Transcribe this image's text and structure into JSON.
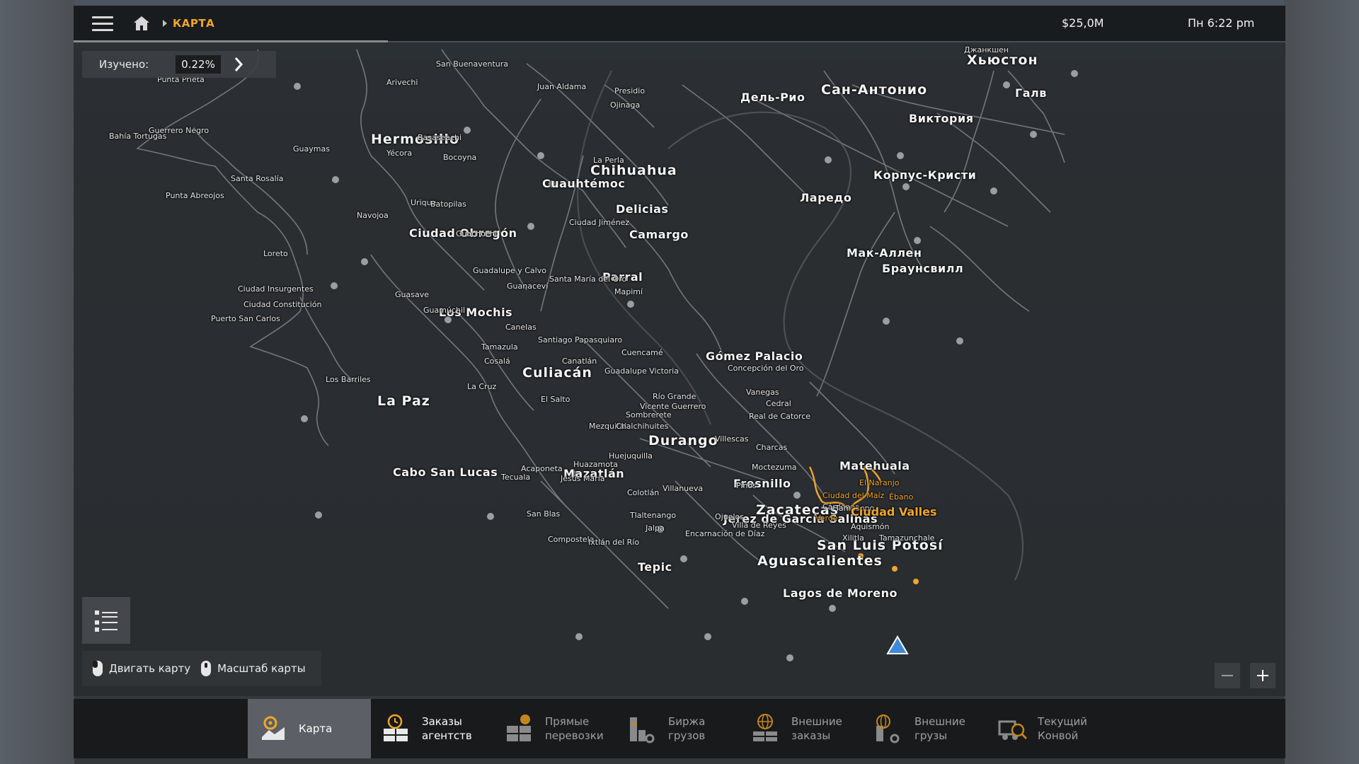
{
  "header": {
    "breadcrumb": "КАРТА",
    "money": "$25,0M",
    "clock": "Пн 6:22 pm"
  },
  "explored": {
    "label": "Изучено:",
    "value": "0.22%"
  },
  "hints": {
    "move": "Двигать карту",
    "zoom": "Масштаб карты"
  },
  "nav": {
    "items": [
      {
        "line1": "Карта",
        "line2": ""
      },
      {
        "line1": "Заказы",
        "line2": "агентств"
      },
      {
        "line1": "Прямые",
        "line2": "перевозки"
      },
      {
        "line1": "Биржа",
        "line2": "грузов"
      },
      {
        "line1": "Внешние",
        "line2": "заказы"
      },
      {
        "line1": "Внешние",
        "line2": "грузы"
      },
      {
        "line1": "Текущий",
        "line2": "Конвой"
      }
    ]
  },
  "cities": {
    "big": [
      {
        "id": "hermosillo",
        "name": "Hermosillo"
      },
      {
        "id": "chihuahua",
        "name": "Chihuahua"
      },
      {
        "id": "cuauhtemoc",
        "name": "Cuauhtémoc"
      },
      {
        "id": "delicias",
        "name": "Delicias"
      },
      {
        "id": "camargo",
        "name": "Camargo"
      },
      {
        "id": "obregon",
        "name": "Ciudad Obregón"
      },
      {
        "id": "parral",
        "name": "Parral"
      },
      {
        "id": "losmochis",
        "name": "Los Mochis"
      },
      {
        "id": "culiacan",
        "name": "Culiacán"
      },
      {
        "id": "gomez",
        "name": "Gómez Palacio"
      },
      {
        "id": "lapaz",
        "name": "La Paz"
      },
      {
        "id": "cabo",
        "name": "Cabo San Lucas"
      },
      {
        "id": "durango",
        "name": "Durango"
      },
      {
        "id": "mazatlan",
        "name": "Mazatlán"
      },
      {
        "id": "fresnillo",
        "name": "Fresnillo"
      },
      {
        "id": "zacatecas",
        "name": "Zacatecas"
      },
      {
        "id": "jerez",
        "name": "Jerez de García Salinas"
      },
      {
        "id": "slp",
        "name": "San Luis Potosí"
      },
      {
        "id": "aguas",
        "name": "Aguascalientes"
      },
      {
        "id": "tepic",
        "name": "Tepic"
      },
      {
        "id": "lagos",
        "name": "Lagos de Moreno"
      },
      {
        "id": "matehuala",
        "name": "Matehuala"
      },
      {
        "id": "houston",
        "name": "Хьюстон"
      },
      {
        "id": "sanantonio",
        "name": "Сан-Антонио"
      },
      {
        "id": "delrio",
        "name": "Дель-Рио"
      },
      {
        "id": "victoria",
        "name": "Виктория"
      },
      {
        "id": "corpus",
        "name": "Корпус-Кристи"
      },
      {
        "id": "laredo",
        "name": "Ларедо"
      },
      {
        "id": "mcallen",
        "name": "Мак-Аллен"
      },
      {
        "id": "brownsville",
        "name": "Браунсвилл"
      },
      {
        "id": "galv",
        "name": "Галв"
      }
    ],
    "small": [
      {
        "id": "sanbuen",
        "name": "San Buenaventura"
      },
      {
        "id": "arivechi",
        "name": "Arivechi"
      },
      {
        "id": "juanaldama",
        "name": "Juan Aldama"
      },
      {
        "id": "presidio",
        "name": "Presidio"
      },
      {
        "id": "ojinaga",
        "name": "Ojinaga"
      },
      {
        "id": "puntaprieta",
        "name": "Punta Prieta"
      },
      {
        "id": "guerreronegro",
        "name": "Guerrero Negro"
      },
      {
        "id": "bahia",
        "name": "Bahía Tortugas"
      },
      {
        "id": "basaseachi",
        "name": "Basaseachi"
      },
      {
        "id": "guaymas",
        "name": "Guaymas"
      },
      {
        "id": "yecora",
        "name": "Yécora"
      },
      {
        "id": "bocoyna",
        "name": "Bocoyna"
      },
      {
        "id": "laperla",
        "name": "La Perla"
      },
      {
        "id": "santarosalia",
        "name": "Santa Rosalía"
      },
      {
        "id": "puntaabreojos",
        "name": "Punta Abreojos"
      },
      {
        "id": "urique",
        "name": "Urique"
      },
      {
        "id": "batopilas",
        "name": "Batopilas"
      },
      {
        "id": "navojoa",
        "name": "Navojoa"
      },
      {
        "id": "cdjimenez",
        "name": "Ciudad Jiménez"
      },
      {
        "id": "guachochi",
        "name": "Guachochi"
      },
      {
        "id": "loreto",
        "name": "Loreto"
      },
      {
        "id": "guadcalvo",
        "name": "Guadalupe y Calvo"
      },
      {
        "id": "guasave",
        "name": "Guasave"
      },
      {
        "id": "guanacevi",
        "name": "Guanaceví"
      },
      {
        "id": "santamaria",
        "name": "Santa María del Oro"
      },
      {
        "id": "cdinsurg",
        "name": "Ciudad Insurgentes"
      },
      {
        "id": "cdconst",
        "name": "Ciudad Constitución"
      },
      {
        "id": "mapimi",
        "name": "Mapimí"
      },
      {
        "id": "puertosc",
        "name": "Puerto San Carlos"
      },
      {
        "id": "guamuchil",
        "name": "Guamúchil"
      },
      {
        "id": "canelas",
        "name": "Canelas"
      },
      {
        "id": "santiagop",
        "name": "Santiago Papasquiaro"
      },
      {
        "id": "tamazula",
        "name": "Tamazula"
      },
      {
        "id": "cuencame",
        "name": "Cuencamé"
      },
      {
        "id": "cosala",
        "name": "Cosalá"
      },
      {
        "id": "canatlan",
        "name": "Canatlán"
      },
      {
        "id": "concepcion",
        "name": "Concepción del Oro"
      },
      {
        "id": "guadvictoria",
        "name": "Guadalupe Victoria"
      },
      {
        "id": "losbarriles",
        "name": "Los Barriles"
      },
      {
        "id": "lacruz",
        "name": "La Cruz"
      },
      {
        "id": "vanegas",
        "name": "Vanegas"
      },
      {
        "id": "riogrande",
        "name": "Río Grande"
      },
      {
        "id": "elsalto",
        "name": "El Salto"
      },
      {
        "id": "vicenteg",
        "name": "Vicente Guerrero"
      },
      {
        "id": "cedral",
        "name": "Cedral"
      },
      {
        "id": "sombrerete",
        "name": "Sombrerete"
      },
      {
        "id": "realcatorce",
        "name": "Real de Catorce"
      },
      {
        "id": "mezquital",
        "name": "Mezquital"
      },
      {
        "id": "chalchihuites",
        "name": "Chalchihuites"
      },
      {
        "id": "villaescusa",
        "name": "Villescas"
      },
      {
        "id": "charcas",
        "name": "Charcas"
      },
      {
        "id": "huejuquilla",
        "name": "Huejuquilla"
      },
      {
        "id": "huazamota",
        "name": "Huazamota"
      },
      {
        "id": "moctezuma",
        "name": "Moctezuma"
      },
      {
        "id": "acaponeta",
        "name": "Acaponeta"
      },
      {
        "id": "tecuala",
        "name": "Tecuala"
      },
      {
        "id": "jesusmaria",
        "name": "Jesús María"
      },
      {
        "id": "pinos",
        "name": "Pinos"
      },
      {
        "id": "colotlan",
        "name": "Colotlán"
      },
      {
        "id": "villanueva",
        "name": "Villanueva"
      },
      {
        "id": "sanblas",
        "name": "San Blas"
      },
      {
        "id": "tlaltenango",
        "name": "Tlaltenango"
      },
      {
        "id": "ojuelos",
        "name": "Ojuelos"
      },
      {
        "id": "villareyes",
        "name": "Villa de Reyes"
      },
      {
        "id": "jalpa",
        "name": "Jalpa"
      },
      {
        "id": "encarnacion",
        "name": "Encarnación de Díaz"
      },
      {
        "id": "compostela",
        "name": "Compostela"
      },
      {
        "id": "ixtlan",
        "name": "Ixtlán del Río"
      },
      {
        "id": "cardenas",
        "name": "Cárdenas"
      },
      {
        "id": "aquismon",
        "name": "Aquismón"
      },
      {
        "id": "xilitla",
        "name": "Xilitla"
      },
      {
        "id": "tamazunchale",
        "name": "Tamazunchale"
      },
      {
        "id": "tamasopo",
        "name": "Tamasopo"
      },
      {
        "id": "dzhankshen",
        "name": "Джанкшен"
      }
    ],
    "orange": [
      {
        "id": "elnaranjo",
        "name": "El Naranjo"
      },
      {
        "id": "cdmaiz",
        "name": "Ciudad del Maíz"
      },
      {
        "id": "ebano",
        "name": "Ébano"
      },
      {
        "id": "verde",
        "name": "Verde"
      },
      {
        "id": "cdvalles",
        "name": "Ciudad Valles"
      }
    ]
  },
  "colors": {
    "accent": "#f0a62b",
    "panel": "#16181a",
    "map_bg": "#2a2c2f",
    "road": "#9a9da0",
    "player_marker": "#3d8bd8"
  },
  "icons": {
    "menu": "hamburger-menu-icon",
    "home": "home-icon",
    "arrow": "chevron-right-icon",
    "legend": "legend-list-icon",
    "mouse": "mouse-icon",
    "zoom_in": "plus-icon",
    "zoom_out": "minus-icon",
    "player": "player-arrow-icon"
  }
}
